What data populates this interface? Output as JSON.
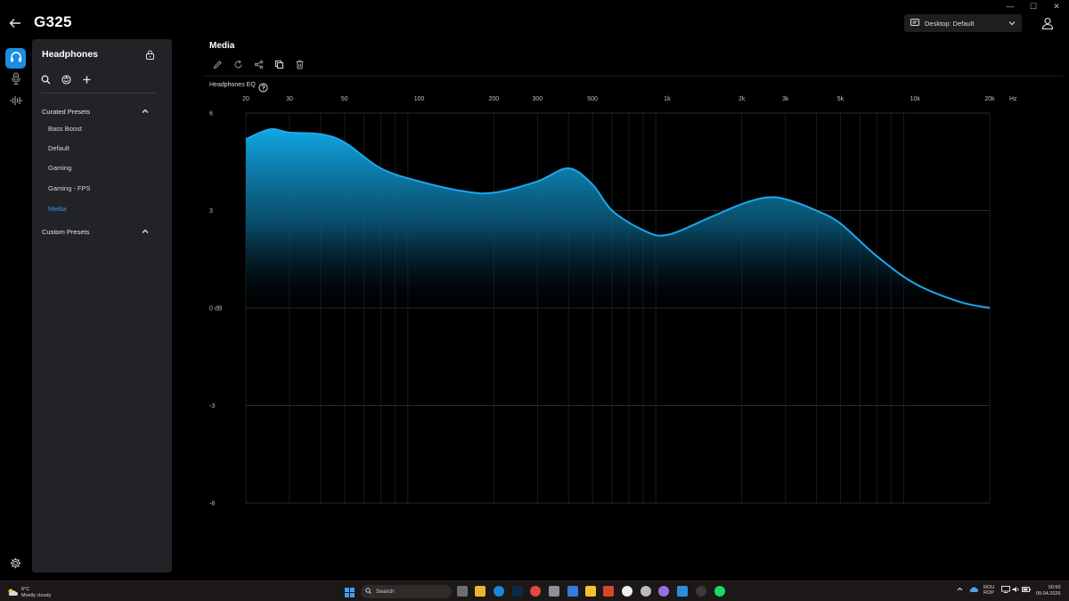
{
  "window_controls": {
    "minimize": "—",
    "maximize": "☐",
    "close": "✕"
  },
  "header": {
    "title": "G325",
    "profile_label": "Desktop: Default"
  },
  "rail": {
    "items": [
      "headphones-icon",
      "microphone-icon",
      "waveform-icon"
    ],
    "settings": "gear-icon"
  },
  "panel": {
    "title": "Headphones",
    "curated_label": "Curated Presets",
    "custom_label": "Custom Presets",
    "presets": [
      "Bass Boost",
      "Default",
      "Gaming",
      "Gaming - FPS",
      "Media"
    ],
    "selected_preset": "Media"
  },
  "main": {
    "title": "Media",
    "toolbar": [
      "pencil-icon",
      "reset-icon",
      "share-icon",
      "copy-icon",
      "trash-icon"
    ],
    "eq_label": "Headphones EQ"
  },
  "chart_data": {
    "type": "area",
    "title": "",
    "xlabel": "Hz",
    "ylabel": "",
    "x_scale": "log",
    "x_ticks": [
      {
        "value": 20,
        "label": "20"
      },
      {
        "value": 30,
        "label": "30"
      },
      {
        "value": 50,
        "label": "50"
      },
      {
        "value": 100,
        "label": "100"
      },
      {
        "value": 200,
        "label": "200"
      },
      {
        "value": 300,
        "label": "300"
      },
      {
        "value": 500,
        "label": "500"
      },
      {
        "value": 1000,
        "label": "1k"
      },
      {
        "value": 2000,
        "label": "2k"
      },
      {
        "value": 3000,
        "label": "3k"
      },
      {
        "value": 5000,
        "label": "5k"
      },
      {
        "value": 10000,
        "label": "10k"
      },
      {
        "value": 20000,
        "label": "20k"
      }
    ],
    "x_unit_label": "Hz",
    "y_ticks": [
      {
        "value": 6,
        "label": "6"
      },
      {
        "value": 3,
        "label": "3"
      },
      {
        "value": 0,
        "label": "0 dB"
      },
      {
        "value": -3,
        "label": "-3"
      },
      {
        "value": -6,
        "label": "-6"
      }
    ],
    "xlim": [
      20,
      20000
    ],
    "ylim": [
      -6,
      6
    ],
    "grid": true,
    "series": [
      {
        "color": "#1aa8f0",
        "points": [
          {
            "x": 20,
            "y": 5.2
          },
          {
            "x": 25,
            "y": 5.5
          },
          {
            "x": 30,
            "y": 5.4
          },
          {
            "x": 40,
            "y": 5.35
          },
          {
            "x": 50,
            "y": 5.1
          },
          {
            "x": 70,
            "y": 4.3
          },
          {
            "x": 100,
            "y": 3.9
          },
          {
            "x": 150,
            "y": 3.6
          },
          {
            "x": 200,
            "y": 3.55
          },
          {
            "x": 300,
            "y": 3.9
          },
          {
            "x": 400,
            "y": 4.3
          },
          {
            "x": 500,
            "y": 3.8
          },
          {
            "x": 600,
            "y": 3.0
          },
          {
            "x": 800,
            "y": 2.4
          },
          {
            "x": 1000,
            "y": 2.25
          },
          {
            "x": 1500,
            "y": 2.8
          },
          {
            "x": 2000,
            "y": 3.2
          },
          {
            "x": 2500,
            "y": 3.4
          },
          {
            "x": 3000,
            "y": 3.35
          },
          {
            "x": 4000,
            "y": 3.0
          },
          {
            "x": 5000,
            "y": 2.6
          },
          {
            "x": 7000,
            "y": 1.6
          },
          {
            "x": 10000,
            "y": 0.75
          },
          {
            "x": 15000,
            "y": 0.2
          },
          {
            "x": 20000,
            "y": 0.0
          }
        ]
      }
    ]
  },
  "taskbar": {
    "weather_temp": "6°C",
    "weather_desc": "Mostly cloudy",
    "search_placeholder": "Search",
    "lang_line1": "ROU",
    "lang_line2": "ROP",
    "time": "00:50",
    "date": "09.04.2026"
  }
}
